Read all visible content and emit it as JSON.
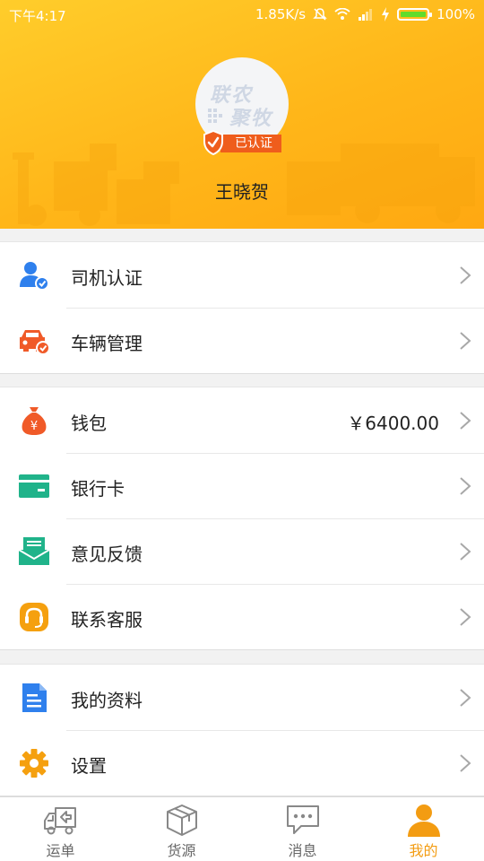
{
  "status_bar": {
    "time": "下午4:17",
    "speed": "1.85K/s",
    "battery": "100%",
    "icons": [
      "mute-icon",
      "wifi-icon",
      "signal-icon",
      "charging-icon",
      "battery-icon"
    ]
  },
  "profile": {
    "avatar_logo_top": "联农",
    "avatar_logo_bottom": "聚牧",
    "verified_badge": "已认证",
    "name": "王晓贺"
  },
  "groups": [
    {
      "items": [
        {
          "label": "司机认证",
          "icon": "driver-verify-icon",
          "color": "#2f80ed"
        },
        {
          "label": "车辆管理",
          "icon": "car-manage-icon",
          "color": "#f05a28"
        }
      ]
    },
    {
      "items": [
        {
          "label": "钱包",
          "icon": "money-bag-icon",
          "color": "#f05a28",
          "value": "￥6400.00"
        },
        {
          "label": "银行卡",
          "icon": "bank-card-icon",
          "color": "#20b38a"
        },
        {
          "label": "意见反馈",
          "icon": "feedback-icon",
          "color": "#20b38a"
        },
        {
          "label": "联系客服",
          "icon": "headset-icon",
          "color": "#f5a00f"
        }
      ]
    },
    {
      "items": [
        {
          "label": "我的资料",
          "icon": "document-icon",
          "color": "#2f80ed"
        },
        {
          "label": "设置",
          "icon": "gear-icon",
          "color": "#f5a00f"
        }
      ]
    }
  ],
  "nav": {
    "items": [
      {
        "label": "运单",
        "icon": "truck-icon",
        "active": false
      },
      {
        "label": "货源",
        "icon": "box-icon",
        "active": false
      },
      {
        "label": "消息",
        "icon": "message-icon",
        "active": false
      },
      {
        "label": "我的",
        "icon": "person-icon",
        "active": true
      }
    ],
    "active_color": "#f39c12",
    "inactive_color": "#666666"
  },
  "colors": {
    "header_gradient_start": "#ffcd2b",
    "header_gradient_end": "#ffa811",
    "badge": "#ef5d1c"
  }
}
